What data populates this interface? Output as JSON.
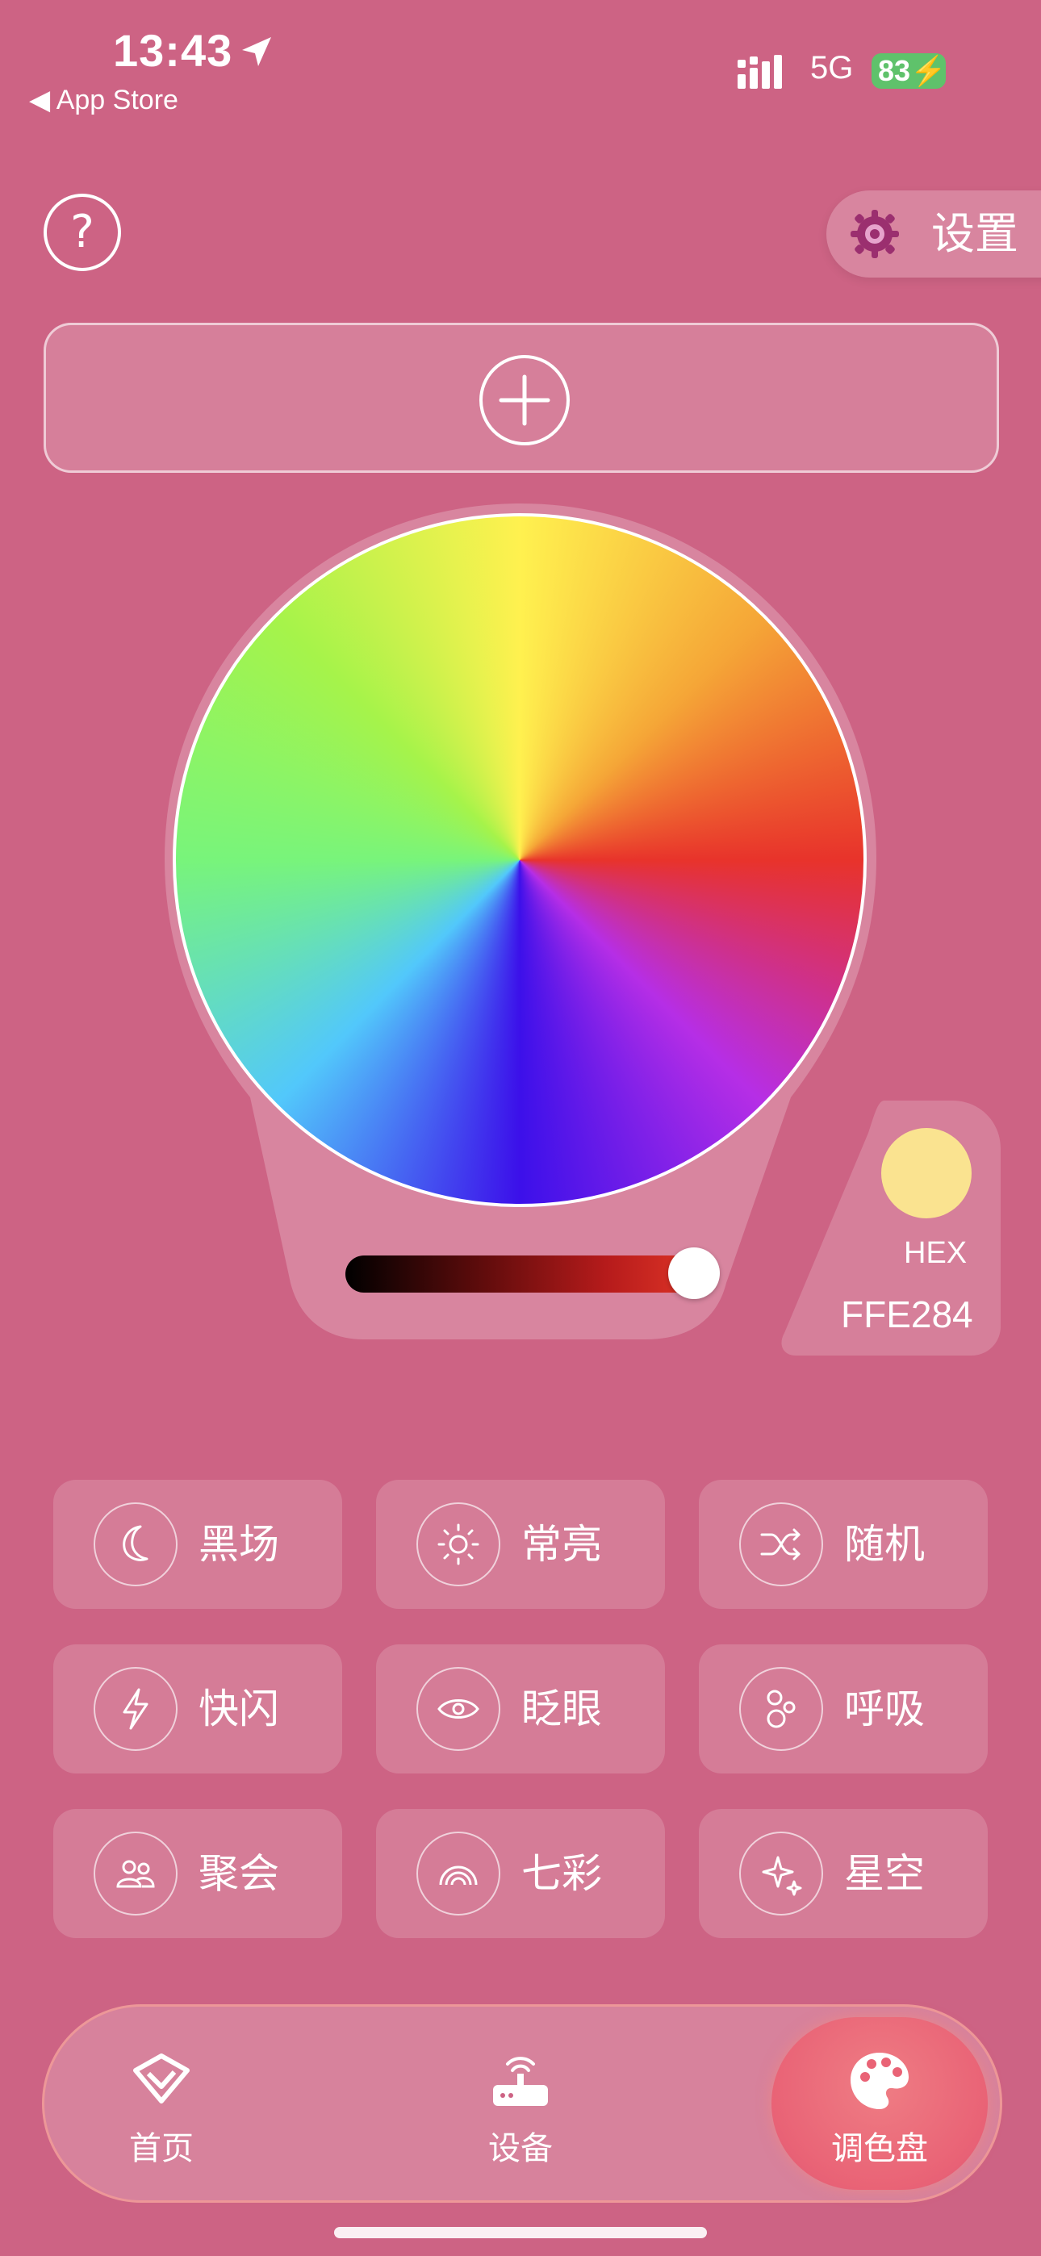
{
  "status_bar": {
    "time": "13:43",
    "back_label": "◀ App Store",
    "network": "5G",
    "battery": "83"
  },
  "header": {
    "help_label": "?",
    "settings_label": "设置"
  },
  "color_picker": {
    "brightness": 1.0,
    "hex_label": "HEX",
    "hex_value": "FFE284",
    "selected_color": "#fae390"
  },
  "modes": [
    {
      "label": "黑场",
      "icon": "moon-icon"
    },
    {
      "label": "常亮",
      "icon": "sun-icon"
    },
    {
      "label": "随机",
      "icon": "shuffle-icon"
    },
    {
      "label": "快闪",
      "icon": "lightning-icon"
    },
    {
      "label": "眨眼",
      "icon": "eye-icon"
    },
    {
      "label": "呼吸",
      "icon": "bubbles-icon"
    },
    {
      "label": "聚会",
      "icon": "people-icon"
    },
    {
      "label": "七彩",
      "icon": "rainbow-icon"
    },
    {
      "label": "星空",
      "icon": "sparkles-icon"
    }
  ],
  "bottom_nav": {
    "active": "调色盘",
    "items": [
      {
        "label": "首页",
        "icon": "home-logo-icon"
      },
      {
        "label": "设备",
        "icon": "router-icon"
      },
      {
        "label": "调色盘",
        "icon": "palette-icon"
      }
    ]
  },
  "colors": {
    "background": "#cd6384",
    "accent": "#e96376",
    "battery": "#5fc26b"
  }
}
